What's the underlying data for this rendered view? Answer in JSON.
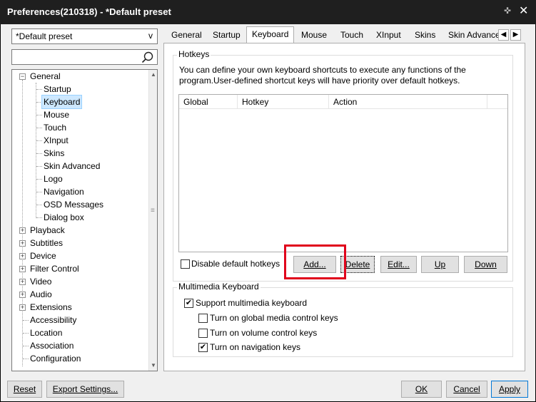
{
  "window": {
    "title": "Preferences(210318) - *Default preset",
    "pin_icon": "pin-icon",
    "close_glyph": "✕"
  },
  "preset": {
    "value": "*Default preset",
    "arrow": "v"
  },
  "search": {
    "value": ""
  },
  "tree": {
    "general": "General",
    "general_children": [
      "Startup",
      "Keyboard",
      "Mouse",
      "Touch",
      "XInput",
      "Skins",
      "Skin Advanced",
      "Logo",
      "Navigation",
      "OSD Messages",
      "Dialog box"
    ],
    "selected": "Keyboard",
    "collapsed": [
      "Playback",
      "Subtitles",
      "Device",
      "Filter Control",
      "Video",
      "Audio",
      "Extensions"
    ],
    "leaves": [
      "Accessibility",
      "Location",
      "Association",
      "Configuration"
    ]
  },
  "tabs": [
    "General",
    "Startup",
    "Keyboard",
    "Mouse",
    "Touch",
    "XInput",
    "Skins",
    "Skin Advance"
  ],
  "active_tab": "Keyboard",
  "hotkeys": {
    "group_label": "Hotkeys",
    "description_line1": "You can define your own keyboard shortcuts to execute any functions of the",
    "description_line2": "program.User-defined shortcut keys will have priority over default hotkeys.",
    "columns": [
      "Global",
      "Hotkey",
      "Action"
    ],
    "disable_default_label": "Disable default hotkeys",
    "disable_default_checked": false,
    "add_label": "Add...",
    "delete_label": "Delete",
    "edit_label": "Edit...",
    "up_label": "Up",
    "down_label": "Down"
  },
  "multimedia": {
    "group_label": "Multimedia Keyboard",
    "support_label": "Support multimedia keyboard",
    "support_checked": true,
    "global_media_label": "Turn on global media control keys",
    "global_media_checked": false,
    "volume_label": "Turn on volume control keys",
    "volume_checked": false,
    "navigation_label": "Turn on navigation keys",
    "navigation_checked": true
  },
  "footer": {
    "reset_label": "Reset",
    "export_label": "Export Settings...",
    "ok_label": "OK",
    "cancel_label": "Cancel",
    "apply_label": "Apply"
  },
  "colors": {
    "titlebar": "#1f1f1f",
    "selection": "#cde8ff",
    "highlight_box": "#e0001b"
  }
}
